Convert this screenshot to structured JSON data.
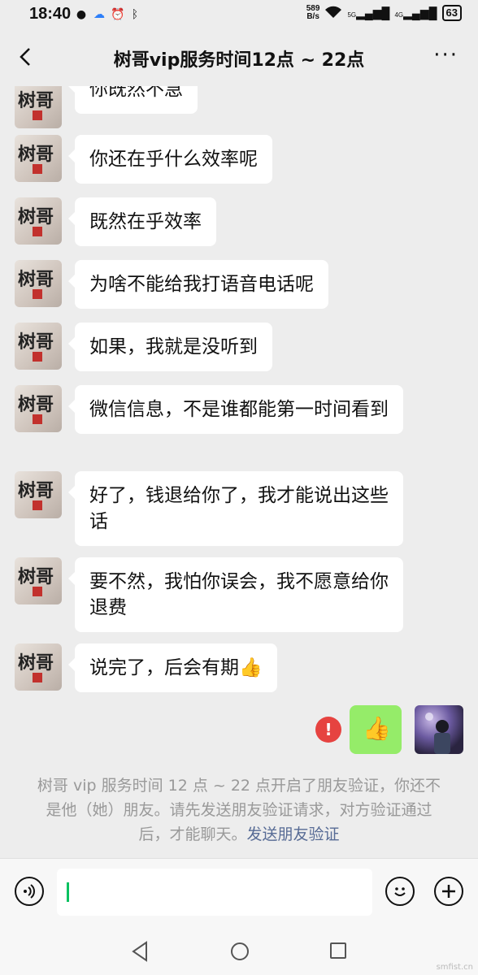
{
  "status": {
    "time": "18:40",
    "net_speed_top": "589",
    "net_speed_unit": "B/s",
    "sig1": "5G",
    "sig2": "4G",
    "battery": "63"
  },
  "header": {
    "title": "树哥vip服务时间12点 ~ 22点",
    "more": "···"
  },
  "contact_avatar_text": "树哥",
  "messages": [
    {
      "text": "你既然不急"
    },
    {
      "text": "你还在乎什么效率呢"
    },
    {
      "text": "既然在乎效率"
    },
    {
      "text": "为啥不能给我打语音电话呢"
    },
    {
      "text": "如果，我就是没听到"
    },
    {
      "text": "微信信息，不是谁都能第一时间看到"
    },
    {
      "text": "好了，钱退给你了，我才能说出这些话"
    },
    {
      "text": "要不然，我怕你误会，我不愿意给你退费"
    },
    {
      "text": "说完了，后会有期👍"
    }
  ],
  "sent": {
    "emoji": "👍",
    "error_mark": "!"
  },
  "system_notice": {
    "text": "树哥 vip 服务时间 12 点 ~ 22 点开启了朋友验证，你还不是他（她）朋友。请先发送朋友验证请求，对方验证通过后，才能聊天。",
    "link": "发送朋友验证"
  },
  "input": {
    "value": ""
  },
  "watermark": "smfist.cn"
}
